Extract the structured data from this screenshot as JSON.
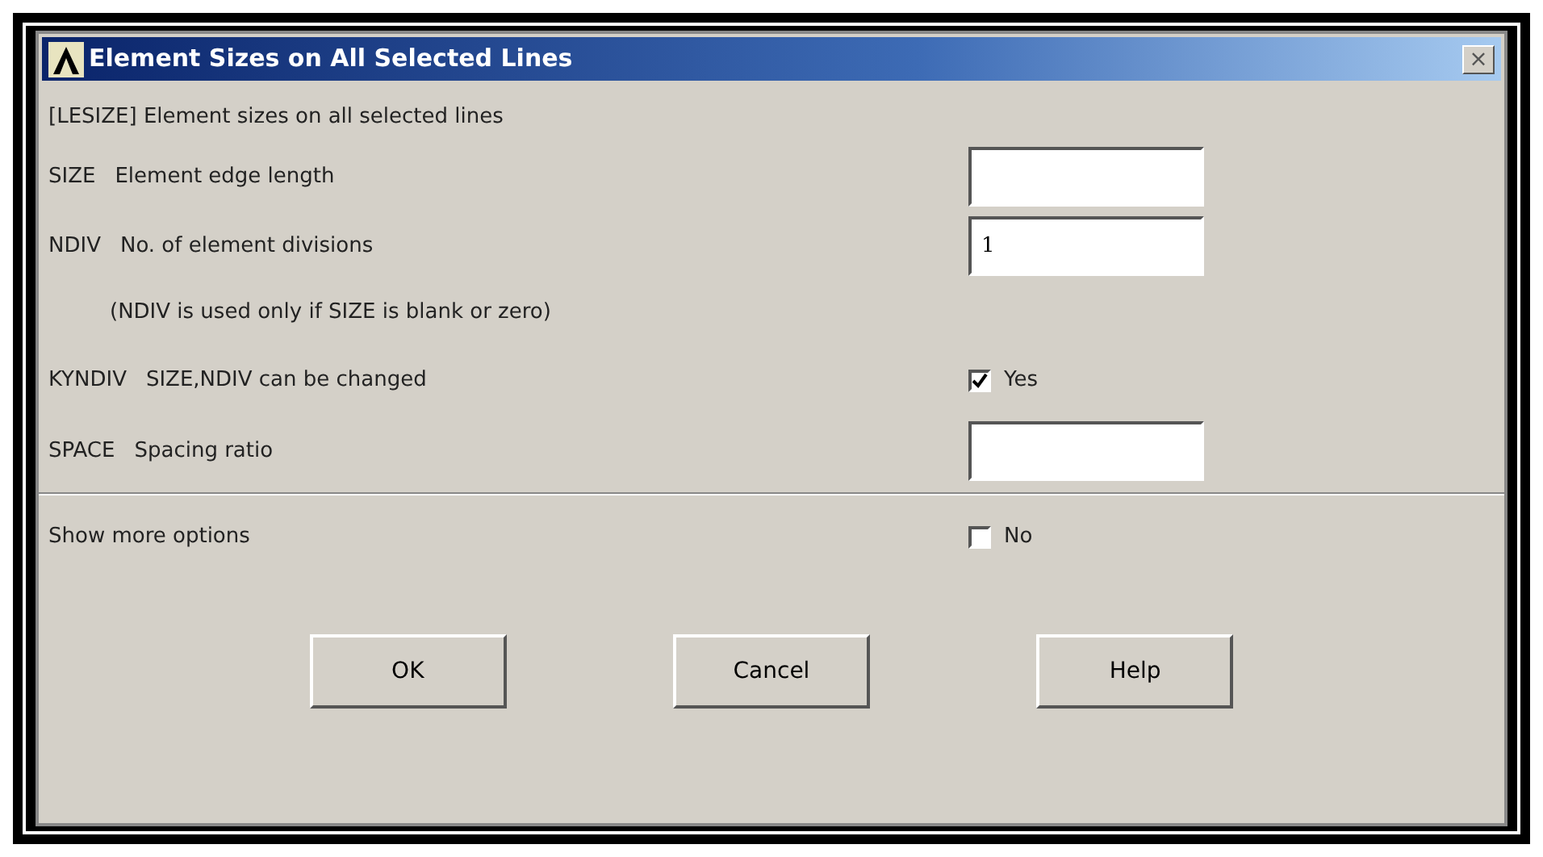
{
  "window": {
    "title": "Element Sizes on All Selected Lines",
    "close": "×"
  },
  "heading": "[LESIZE]  Element sizes on all selected lines",
  "rows": [
    {
      "kind": "field",
      "code": "SIZE",
      "label": "Element edge length",
      "value": ""
    },
    {
      "kind": "field",
      "code": "NDIV",
      "label": "No. of element divisions",
      "value": "1"
    },
    {
      "kind": "note",
      "label": "(NDIV is used only if SIZE is blank or zero)"
    },
    {
      "kind": "checkbox",
      "code": "KYNDIV",
      "label": "SIZE,NDIV can be changed",
      "checked": true,
      "option": "Yes"
    },
    {
      "kind": "field",
      "code": "SPACE",
      "label": "Spacing ratio",
      "value": ""
    },
    {
      "kind": "separator"
    },
    {
      "kind": "checkbox",
      "label": "Show more options",
      "checked": false,
      "option": "No"
    }
  ],
  "buttons": [
    "OK",
    "Cancel",
    "Help"
  ]
}
